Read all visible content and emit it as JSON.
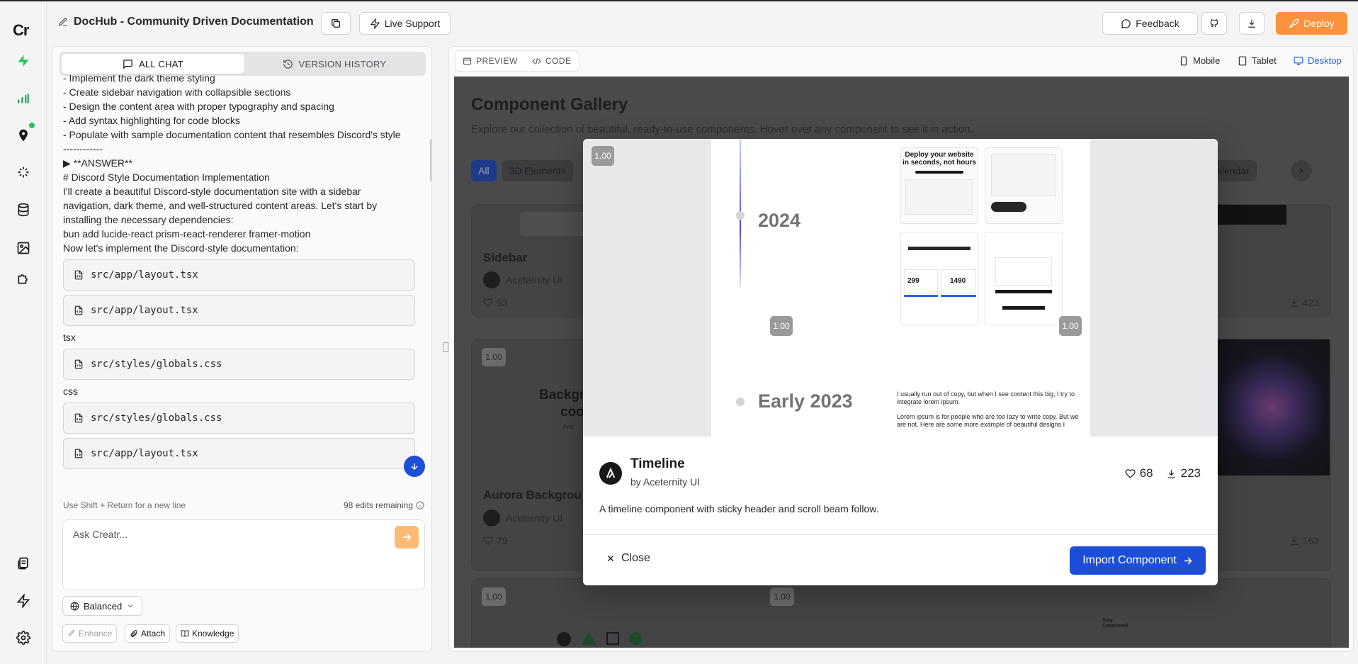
{
  "app": {
    "logo": "Cr",
    "project_title": "DocHub - Community Driven Documentation",
    "live_support": "Live Support",
    "feedback": "Feedback",
    "deploy": "Deploy"
  },
  "left_panel": {
    "tab_chat": "ALL CHAT",
    "tab_history": "VERSION HISTORY",
    "chat_lines": [
      "- Implement the dark theme styling",
      "- Create sidebar navigation with collapsible sections",
      "- Design the content area with proper typography and spacing",
      "- Add syntax highlighting for code blocks",
      "- Populate with sample documentation content that resembles Discord's style",
      "------------",
      "▶ **ANSWER**",
      "# Discord Style Documentation Implementation",
      "I'll create a beautiful Discord-style documentation site with a sidebar",
      "navigation, dark theme, and well-structured content areas. Let's start by",
      "installing the necessary dependencies:",
      "bun add lucide-react prism-react-renderer framer-motion",
      "Now let's implement the Discord-style documentation:"
    ],
    "files": {
      "f1": "src/app/layout.tsx",
      "f2": "src/app/layout.tsx",
      "label1": "tsx",
      "f3": "src/styles/globals.css",
      "label2": "css",
      "f4": "src/styles/globals.css",
      "f5": "src/app/layout.tsx"
    },
    "hint": "Use Shift + Return for a new line",
    "edits_remaining": "98 edits remaining",
    "input_placeholder": "Ask Creatr...",
    "mode": "Balanced",
    "enhance": "Enhance",
    "attach": "Attach",
    "knowledge": "Knowledge"
  },
  "right_panel": {
    "preview_tab": "PREVIEW",
    "code_tab": "CODE",
    "devices": {
      "mobile": "Mobile",
      "tablet": "Tablet",
      "desktop": "Desktop"
    }
  },
  "gallery": {
    "title": "Component Gallery",
    "subtitle": "Explore our collection of beautiful, ready-to-use components. Hover over any component to see it in action.",
    "filters": {
      "all": "All",
      "three_d": "3D Elements",
      "calendar": "Calendar"
    },
    "cards": {
      "sidebar": {
        "title": "Sidebar",
        "author": "Aceternity UI",
        "likes": "93",
        "downloads": "423"
      },
      "aurora": {
        "title": "Aurora Backgrou",
        "author": "Aceternity UI",
        "likes": "79",
        "downloads": "163"
      },
      "bg_title": "Backgr",
      "bg_sub": "coo",
      "bg_tiny": "And",
      "nav_title": "Stay Connected"
    },
    "badge": "1.00"
  },
  "modal": {
    "badge": "1.00",
    "preview": {
      "year1": "2024",
      "year2": "Early 2023",
      "hero": "Deploy your website in seconds, not hours",
      "price1": "299",
      "price2": "1490",
      "para1": "I usually run out of copy, but when I see content this big, I try to integrate lorem ipsum.",
      "para2": "Lorem ipsum is for people who are too lazy to write copy. But we are not. Here are some more example of beautiful designs I"
    },
    "name": "Timeline",
    "author": "by Aceternity UI",
    "likes": "68",
    "downloads": "223",
    "description": "A timeline component with sticky header and scroll beam follow.",
    "close": "Close",
    "import": "Import Component"
  }
}
